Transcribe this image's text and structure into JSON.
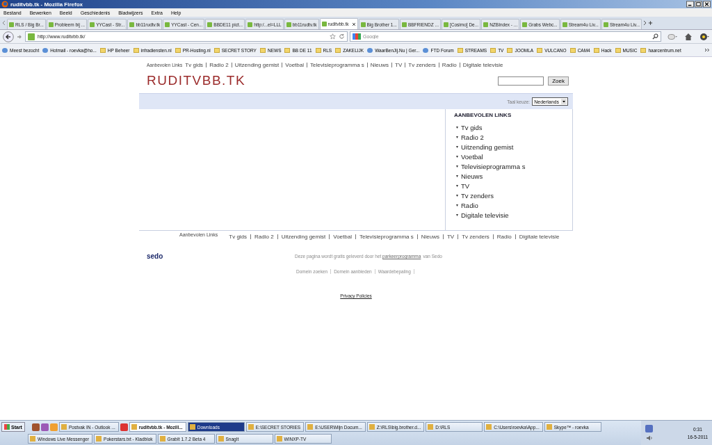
{
  "window": {
    "title": "ruditvbb.tk - Mozilla Firefox"
  },
  "menu": [
    "Bestand",
    "Bewerken",
    "Beeld",
    "Geschiedenis",
    "Bladwijzers",
    "Extra",
    "Help"
  ],
  "tabs": [
    {
      "label": "RLS / Big Br...",
      "selected": false
    },
    {
      "label": "Probleem bij ...",
      "selected": false
    },
    {
      "label": "YYCast - Str...",
      "selected": false
    },
    {
      "label": "bb11rudtv.tk",
      "selected": false
    },
    {
      "label": "YYCast - Cen...",
      "selected": false
    },
    {
      "label": "BBDE11 pict...",
      "selected": false
    },
    {
      "label": "http:/...el=LLL",
      "selected": false
    },
    {
      "label": "bb11rudtv.tk",
      "selected": false
    },
    {
      "label": "ruditvbb.tk",
      "selected": true
    },
    {
      "label": "Big Brother 1...",
      "selected": false
    },
    {
      "label": "BBFRIENDZ ...",
      "selected": false
    },
    {
      "label": "[Cosimo] De...",
      "selected": false
    },
    {
      "label": "NZBIndex - ...",
      "selected": false
    },
    {
      "label": "Grabs Webc...",
      "selected": false
    },
    {
      "label": "Stream4u Liv...",
      "selected": false
    },
    {
      "label": "Stream4u Liv...",
      "selected": false
    }
  ],
  "address": {
    "value": "http://www.ruditvbb.tk/"
  },
  "search": {
    "placeholder": "Google"
  },
  "bookmarks": [
    {
      "label": "Meest bezocht",
      "kind": "link"
    },
    {
      "label": "Hotmail - roevka@ho...",
      "kind": "link"
    },
    {
      "label": "HP Beheer",
      "kind": "folder"
    },
    {
      "label": "infradiensten.nl",
      "kind": "folder"
    },
    {
      "label": "PR-Hosting.nl",
      "kind": "folder"
    },
    {
      "label": "SECRET STORY",
      "kind": "folder"
    },
    {
      "label": "NEWS",
      "kind": "folder"
    },
    {
      "label": "BB DE 11",
      "kind": "folder"
    },
    {
      "label": "RLS",
      "kind": "folder"
    },
    {
      "label": "ZAKELIJK",
      "kind": "folder"
    },
    {
      "label": "WaarBenJij.Nu | Ger...",
      "kind": "link"
    },
    {
      "label": "FTD Forum",
      "kind": "link"
    },
    {
      "label": "STREAMS",
      "kind": "folder"
    },
    {
      "label": "TV",
      "kind": "folder"
    },
    {
      "label": "JOOMLA",
      "kind": "folder"
    },
    {
      "label": "VULCANO",
      "kind": "folder"
    },
    {
      "label": "CAM4",
      "kind": "folder"
    },
    {
      "label": "Hack",
      "kind": "folder"
    },
    {
      "label": "MUSIC",
      "kind": "folder"
    },
    {
      "label": "haarcentrum.net",
      "kind": "folder"
    }
  ],
  "page": {
    "top_label": "Aanbevolen Links",
    "top_links": [
      "Tv gids",
      "Radio 2",
      "Uitzending gemist",
      "Voetbal",
      "Televisieprogramma s",
      "Nieuws",
      "TV",
      "Tv zenders",
      "Radio",
      "Digitale televisie"
    ],
    "logo": "RUDITVBB.TK",
    "search_button": "Zoek",
    "language_label": "Taal keuze:",
    "language": "Nederlands",
    "box_heading": "AANBEVOLEN LINKS",
    "box_links": [
      "Tv gids",
      "Radio 2",
      "Uitzending gemist",
      "Voetbal",
      "Televisieprogramma s",
      "Nieuws",
      "TV",
      "Tv zenders",
      "Radio",
      "Digitale televisie"
    ],
    "footer_label": "Aanbevolen Links",
    "footer_links": [
      "Tv gids",
      "Radio 2",
      "Uitzending gemist",
      "Voetbal",
      "Televisieprogramma s",
      "Nieuws",
      "TV",
      "Tv zenders",
      "Radio",
      "Digitale televisie"
    ],
    "sedo_logo": "sedo",
    "notice": "Deze pagina wordt gratis geleverd door het",
    "notice_link": "parkeerprogramma",
    "notice_end": "van Sedo",
    "domain_links": [
      "Domein zoeken",
      "Domein aanbieden",
      "Waardebepaling"
    ],
    "privacy": "Privacy Policies"
  },
  "taskbar": {
    "start": "Start",
    "row1": [
      {
        "label": "Postvak IN - Outlook ...",
        "selected": false,
        "flashing": false
      },
      {
        "label": "ruditvbb.tk - Mozill...",
        "selected": true,
        "flashing": false
      },
      {
        "label": "Downloads",
        "selected": false,
        "flashing": true
      },
      {
        "label": "E:\\SECRET STORIES",
        "selected": false,
        "flashing": false
      },
      {
        "label": "E:\\USER\\Mijn Docum...",
        "selected": false,
        "flashing": false
      },
      {
        "label": "Z:\\RLS\\big.brother.d...",
        "selected": false,
        "flashing": false
      },
      {
        "label": "D:\\RLS",
        "selected": false,
        "flashing": false
      },
      {
        "label": "C:\\Users\\roevka\\App...",
        "selected": false,
        "flashing": false
      },
      {
        "label": "Skype™ - roevka",
        "selected": false,
        "flashing": false
      }
    ],
    "row2": [
      {
        "label": "Windows Live Messenger",
        "selected": false,
        "flashing": false
      },
      {
        "label": "Pokerstars.txt - Kladblok",
        "selected": false,
        "flashing": false
      },
      {
        "label": "GrabIt 1.7.2 Beta 4",
        "selected": false,
        "flashing": false
      },
      {
        "label": "SnagIt",
        "selected": false,
        "flashing": false
      },
      {
        "label": "WINXP-TV",
        "selected": false,
        "flashing": false
      }
    ],
    "time": "0:31",
    "date": "16-5-2011"
  }
}
